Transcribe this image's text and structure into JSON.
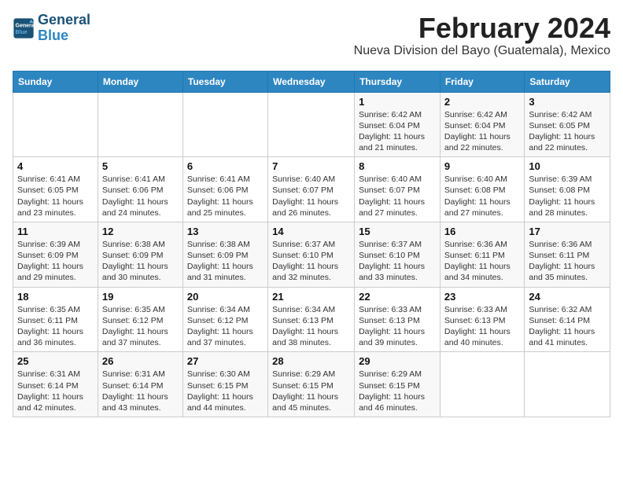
{
  "header": {
    "logo_line1": "General",
    "logo_line2": "Blue",
    "month_title": "February 2024",
    "location": "Nueva Division del Bayo (Guatemala), Mexico"
  },
  "weekdays": [
    "Sunday",
    "Monday",
    "Tuesday",
    "Wednesday",
    "Thursday",
    "Friday",
    "Saturday"
  ],
  "weeks": [
    [
      {
        "day": "",
        "info": ""
      },
      {
        "day": "",
        "info": ""
      },
      {
        "day": "",
        "info": ""
      },
      {
        "day": "",
        "info": ""
      },
      {
        "day": "1",
        "info": "Sunrise: 6:42 AM\nSunset: 6:04 PM\nDaylight: 11 hours\nand 21 minutes."
      },
      {
        "day": "2",
        "info": "Sunrise: 6:42 AM\nSunset: 6:04 PM\nDaylight: 11 hours\nand 22 minutes."
      },
      {
        "day": "3",
        "info": "Sunrise: 6:42 AM\nSunset: 6:05 PM\nDaylight: 11 hours\nand 22 minutes."
      }
    ],
    [
      {
        "day": "4",
        "info": "Sunrise: 6:41 AM\nSunset: 6:05 PM\nDaylight: 11 hours\nand 23 minutes."
      },
      {
        "day": "5",
        "info": "Sunrise: 6:41 AM\nSunset: 6:06 PM\nDaylight: 11 hours\nand 24 minutes."
      },
      {
        "day": "6",
        "info": "Sunrise: 6:41 AM\nSunset: 6:06 PM\nDaylight: 11 hours\nand 25 minutes."
      },
      {
        "day": "7",
        "info": "Sunrise: 6:40 AM\nSunset: 6:07 PM\nDaylight: 11 hours\nand 26 minutes."
      },
      {
        "day": "8",
        "info": "Sunrise: 6:40 AM\nSunset: 6:07 PM\nDaylight: 11 hours\nand 27 minutes."
      },
      {
        "day": "9",
        "info": "Sunrise: 6:40 AM\nSunset: 6:08 PM\nDaylight: 11 hours\nand 27 minutes."
      },
      {
        "day": "10",
        "info": "Sunrise: 6:39 AM\nSunset: 6:08 PM\nDaylight: 11 hours\nand 28 minutes."
      }
    ],
    [
      {
        "day": "11",
        "info": "Sunrise: 6:39 AM\nSunset: 6:09 PM\nDaylight: 11 hours\nand 29 minutes."
      },
      {
        "day": "12",
        "info": "Sunrise: 6:38 AM\nSunset: 6:09 PM\nDaylight: 11 hours\nand 30 minutes."
      },
      {
        "day": "13",
        "info": "Sunrise: 6:38 AM\nSunset: 6:09 PM\nDaylight: 11 hours\nand 31 minutes."
      },
      {
        "day": "14",
        "info": "Sunrise: 6:37 AM\nSunset: 6:10 PM\nDaylight: 11 hours\nand 32 minutes."
      },
      {
        "day": "15",
        "info": "Sunrise: 6:37 AM\nSunset: 6:10 PM\nDaylight: 11 hours\nand 33 minutes."
      },
      {
        "day": "16",
        "info": "Sunrise: 6:36 AM\nSunset: 6:11 PM\nDaylight: 11 hours\nand 34 minutes."
      },
      {
        "day": "17",
        "info": "Sunrise: 6:36 AM\nSunset: 6:11 PM\nDaylight: 11 hours\nand 35 minutes."
      }
    ],
    [
      {
        "day": "18",
        "info": "Sunrise: 6:35 AM\nSunset: 6:11 PM\nDaylight: 11 hours\nand 36 minutes."
      },
      {
        "day": "19",
        "info": "Sunrise: 6:35 AM\nSunset: 6:12 PM\nDaylight: 11 hours\nand 37 minutes."
      },
      {
        "day": "20",
        "info": "Sunrise: 6:34 AM\nSunset: 6:12 PM\nDaylight: 11 hours\nand 37 minutes."
      },
      {
        "day": "21",
        "info": "Sunrise: 6:34 AM\nSunset: 6:13 PM\nDaylight: 11 hours\nand 38 minutes."
      },
      {
        "day": "22",
        "info": "Sunrise: 6:33 AM\nSunset: 6:13 PM\nDaylight: 11 hours\nand 39 minutes."
      },
      {
        "day": "23",
        "info": "Sunrise: 6:33 AM\nSunset: 6:13 PM\nDaylight: 11 hours\nand 40 minutes."
      },
      {
        "day": "24",
        "info": "Sunrise: 6:32 AM\nSunset: 6:14 PM\nDaylight: 11 hours\nand 41 minutes."
      }
    ],
    [
      {
        "day": "25",
        "info": "Sunrise: 6:31 AM\nSunset: 6:14 PM\nDaylight: 11 hours\nand 42 minutes."
      },
      {
        "day": "26",
        "info": "Sunrise: 6:31 AM\nSunset: 6:14 PM\nDaylight: 11 hours\nand 43 minutes."
      },
      {
        "day": "27",
        "info": "Sunrise: 6:30 AM\nSunset: 6:15 PM\nDaylight: 11 hours\nand 44 minutes."
      },
      {
        "day": "28",
        "info": "Sunrise: 6:29 AM\nSunset: 6:15 PM\nDaylight: 11 hours\nand 45 minutes."
      },
      {
        "day": "29",
        "info": "Sunrise: 6:29 AM\nSunset: 6:15 PM\nDaylight: 11 hours\nand 46 minutes."
      },
      {
        "day": "",
        "info": ""
      },
      {
        "day": "",
        "info": ""
      }
    ]
  ]
}
